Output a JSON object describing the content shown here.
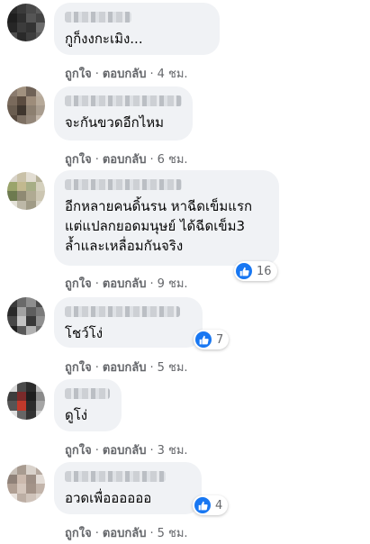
{
  "comments": [
    {
      "text": "กูก็งงกะเมิง...",
      "like_label": "ถูกใจ",
      "reply_label": "ตอบกลับ",
      "time": "4 ชม.",
      "reactions": null
    },
    {
      "text": "จะกันขวดอีกไหม",
      "like_label": "ถูกใจ",
      "reply_label": "ตอบกลับ",
      "time": "6 ชม.",
      "reactions": null
    },
    {
      "text": "อีกหลายคนดิ้นรน หาฉีดเข็มแรก\nแต่แปลกยอดมนุษย์ ได้ฉีดเข็ม3\nล้ำและเหลื่อมกันจริง",
      "like_label": "ถูกใจ",
      "reply_label": "ตอบกลับ",
      "time": "9 ชม.",
      "reactions": "16"
    },
    {
      "text": "โชว์โง่",
      "like_label": "ถูกใจ",
      "reply_label": "ตอบกลับ",
      "time": "5 ชม.",
      "reactions": "7"
    },
    {
      "text": "ดูโง่",
      "like_label": "ถูกใจ",
      "reply_label": "ตอบกลับ",
      "time": "3 ชม.",
      "reactions": null
    },
    {
      "text": "อวดเพื่ออออออ",
      "like_label": "ถูกใจ",
      "reply_label": "ตอบกลับ",
      "time": "5 ชม.",
      "reactions": "4"
    }
  ],
  "separator": "·",
  "colors": {
    "bubble": "#f0f2f5",
    "text": "#050505",
    "meta": "#65676b",
    "like_blue": "#1877f2"
  },
  "icons": {
    "reaction": "thumbs-up-icon"
  }
}
